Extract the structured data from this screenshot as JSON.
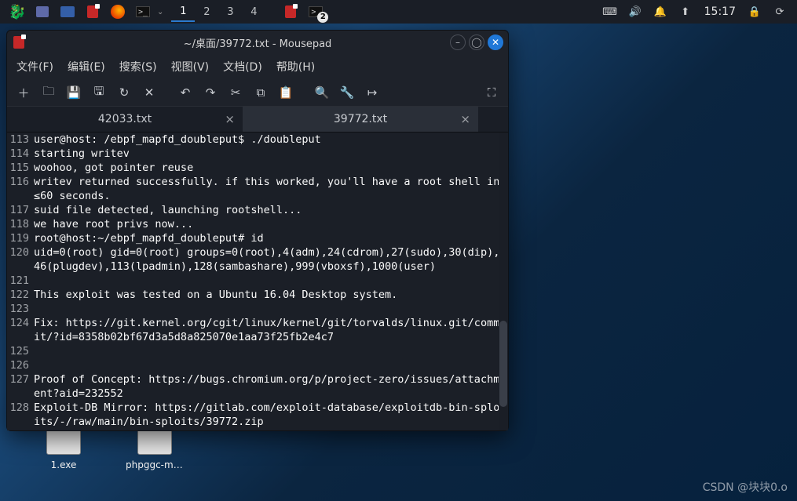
{
  "taskbar": {
    "workspaces": [
      "1",
      "2",
      "3",
      "4"
    ],
    "active_workspace": 0,
    "badge": "2",
    "clock": "15:17"
  },
  "window": {
    "title": "~/桌面/39772.txt - Mousepad"
  },
  "menubar": {
    "file": "文件(F)",
    "edit": "编辑(E)",
    "search": "搜索(S)",
    "view": "视图(V)",
    "document": "文档(D)",
    "help": "帮助(H)"
  },
  "tabs": {
    "inactive_name": "42033.txt",
    "active_name": "39772.txt"
  },
  "editor": {
    "lines": [
      {
        "n": "113",
        "t": "user@host: /ebpf_mapfd_doubleput$ ./doubleput"
      },
      {
        "n": "114",
        "t": "starting writev"
      },
      {
        "n": "115",
        "t": "woohoo, got pointer reuse"
      },
      {
        "n": "116",
        "t": "writev returned successfully. if this worked, you'll have a root shell in ≤60 seconds."
      },
      {
        "n": "117",
        "t": "suid file detected, launching rootshell..."
      },
      {
        "n": "118",
        "t": "we have root privs now..."
      },
      {
        "n": "119",
        "t": "root@host:~/ebpf_mapfd_doubleput# id"
      },
      {
        "n": "120",
        "t": "uid=0(root) gid=0(root) groups=0(root),4(adm),24(cdrom),27(sudo),30(dip),46(plugdev),113(lpadmin),128(sambashare),999(vboxsf),1000(user)"
      },
      {
        "n": "121",
        "t": ""
      },
      {
        "n": "122",
        "t": "This exploit was tested on a Ubuntu 16.04 Desktop system."
      },
      {
        "n": "123",
        "t": ""
      },
      {
        "n": "124",
        "t": "Fix: https://git.kernel.org/cgit/linux/kernel/git/torvalds/linux.git/commit/?id=8358b02bf67d3a5d8a825070e1aa73f25fb2e4c7"
      },
      {
        "n": "125",
        "t": ""
      },
      {
        "n": "126",
        "t": ""
      },
      {
        "n": "127",
        "t": "Proof of Concept: https://bugs.chromium.org/p/project-zero/issues/attachment?aid=232552"
      },
      {
        "n": "128",
        "t": "Exploit-DB Mirror: https://gitlab.com/exploit-database/exploitdb-bin-sploits/-/raw/main/bin-sploits/39772.zip"
      }
    ]
  },
  "desktop": {
    "icons": [
      {
        "label": "1.exe"
      },
      {
        "label": "phpggc-ma…"
      }
    ]
  },
  "watermark": "CSDN @块块0.o"
}
